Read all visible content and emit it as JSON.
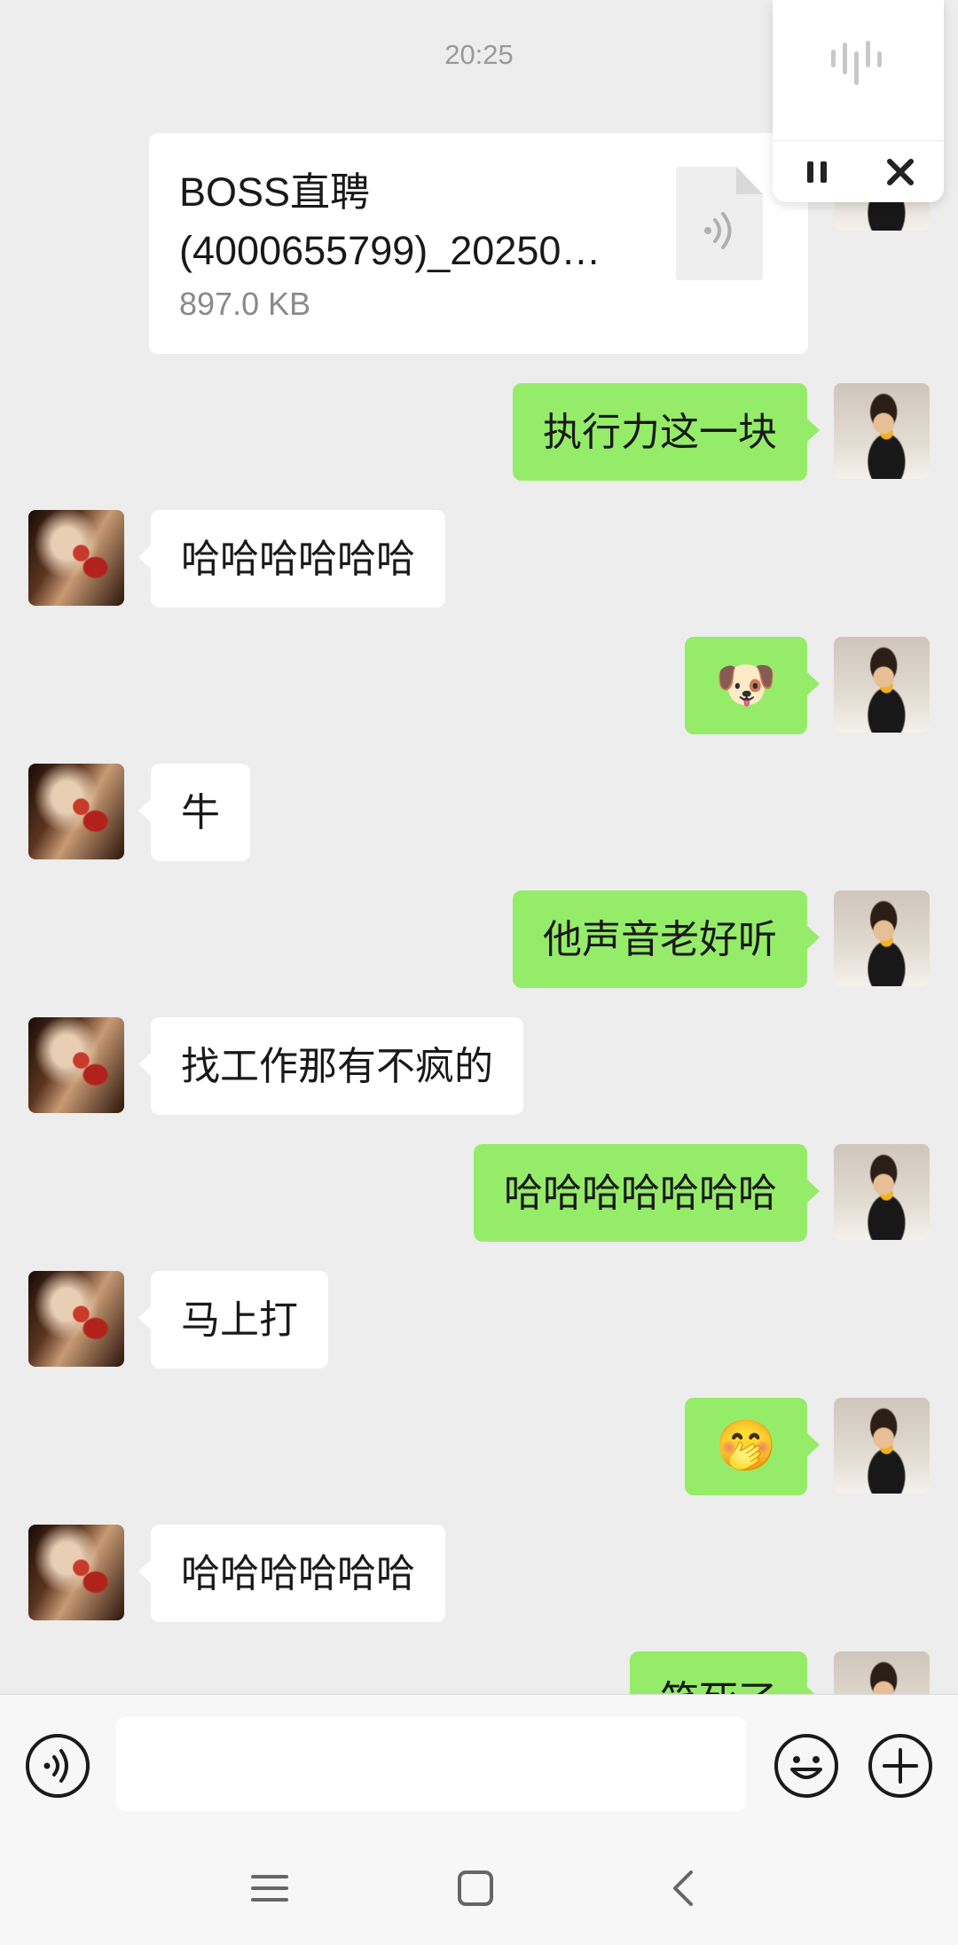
{
  "chat": {
    "timestamp": "20:25",
    "file_card": {
      "name_line1": "BOSS直聘",
      "name_line2": "(4000655799)_20250…",
      "size": "897.0 KB",
      "icon": "audio-file-icon"
    },
    "messages": [
      {
        "sender": "me",
        "text": "执行力这一块"
      },
      {
        "sender": "them",
        "text": "哈哈哈哈哈哈"
      },
      {
        "sender": "me",
        "text": "🐶",
        "type": "emoji",
        "emoji_name": "doge-emoji"
      },
      {
        "sender": "them",
        "text": "牛"
      },
      {
        "sender": "me",
        "text": "他声音老好听"
      },
      {
        "sender": "them",
        "text": "找工作那有不疯的"
      },
      {
        "sender": "me",
        "text": "哈哈哈哈哈哈哈"
      },
      {
        "sender": "them",
        "text": "马上打"
      },
      {
        "sender": "me",
        "text": "🤭",
        "type": "emoji",
        "emoji_name": "cover-mouth-emoji"
      },
      {
        "sender": "them",
        "text": "哈哈哈哈哈哈"
      },
      {
        "sender": "me",
        "text": "笑死了"
      }
    ]
  },
  "voice_float": {
    "wave_icon": "voice-wave-icon",
    "pause_icon": "pause-icon",
    "close_icon": "close-icon"
  },
  "input_bar": {
    "voice_icon": "voice-input-icon",
    "text_value": "",
    "emoji_icon": "emoji-icon",
    "more_icon": "plus-icon"
  },
  "system_nav": {
    "menu_icon": "menu-icon",
    "home_icon": "home-icon",
    "back_icon": "back-icon"
  },
  "colors": {
    "background": "#ededed",
    "outgoing_bubble": "#95ec69",
    "incoming_bubble": "#ffffff",
    "timestamp_text": "#9a9a9a"
  }
}
